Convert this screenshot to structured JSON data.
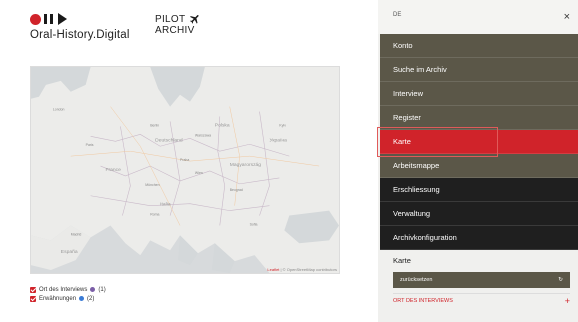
{
  "brand": {
    "logo_text": "Oral-History.Digital",
    "pilot_line1": "PILOT",
    "pilot_line2": "ARCHIV"
  },
  "map": {
    "attribution_link": "Leaflet",
    "attribution_rest": "| © OpenStreetMap contributors"
  },
  "legend": [
    {
      "label": "Ort des Interviews",
      "count": "(1)",
      "dot_color": "#7b5ea7",
      "checked": true
    },
    {
      "label": "Erwähnungen",
      "count": "(2)",
      "dot_color": "#3a7bd5",
      "checked": true
    }
  ],
  "sidebar": {
    "language": "DE",
    "close_icon": "×",
    "menu": [
      {
        "label": "Konto",
        "style": "olive"
      },
      {
        "label": "Suche im Archiv",
        "style": "olive"
      },
      {
        "label": "Interview",
        "style": "olive"
      },
      {
        "label": "Register",
        "style": "olive"
      },
      {
        "label": "Karte",
        "style": "red",
        "active": true
      },
      {
        "label": "Arbeitsmappe",
        "style": "olive"
      },
      {
        "label": "Erschliessung",
        "style": "black"
      },
      {
        "label": "Verwaltung",
        "style": "black"
      },
      {
        "label": "Archivkonfiguration",
        "style": "black"
      }
    ],
    "karte_title": "Karte",
    "reset_label": "zurücksetzen",
    "reset_icon": "↻",
    "ort_label": "ORT DES INTERVIEWS",
    "ort_icon": "+"
  },
  "colors": {
    "accent": "#d0232a",
    "olive": "#5b5748",
    "dark": "#1f1f1f"
  }
}
